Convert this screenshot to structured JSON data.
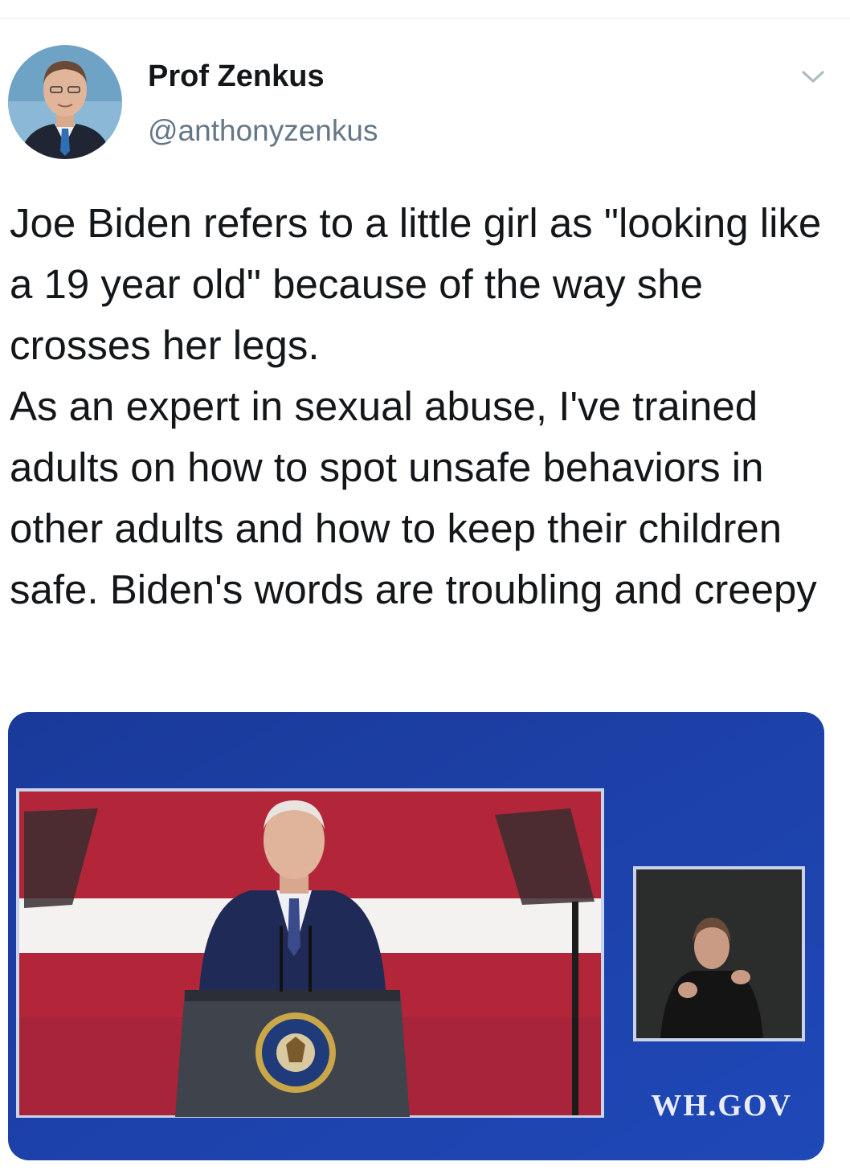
{
  "tweet": {
    "author": {
      "display_name": "Prof Zenkus",
      "handle": "@anthonyzenkus"
    },
    "text": "Joe Biden refers to a little girl as \"looking like a 19 year old\" because of the way she crosses her legs.\nAs an expert in sexual abuse, I've trained adults on how to spot unsafe behaviors in other adults and how to keep their children safe. Biden's words are troubling and creepy",
    "menu_icon": "chevron-down-icon",
    "media": {
      "watermark": "WH.GOV"
    }
  },
  "colors": {
    "text_primary": "#14171a",
    "text_secondary": "#657786",
    "media_background": "#1b3fa3",
    "flag_red": "#b3263a"
  }
}
